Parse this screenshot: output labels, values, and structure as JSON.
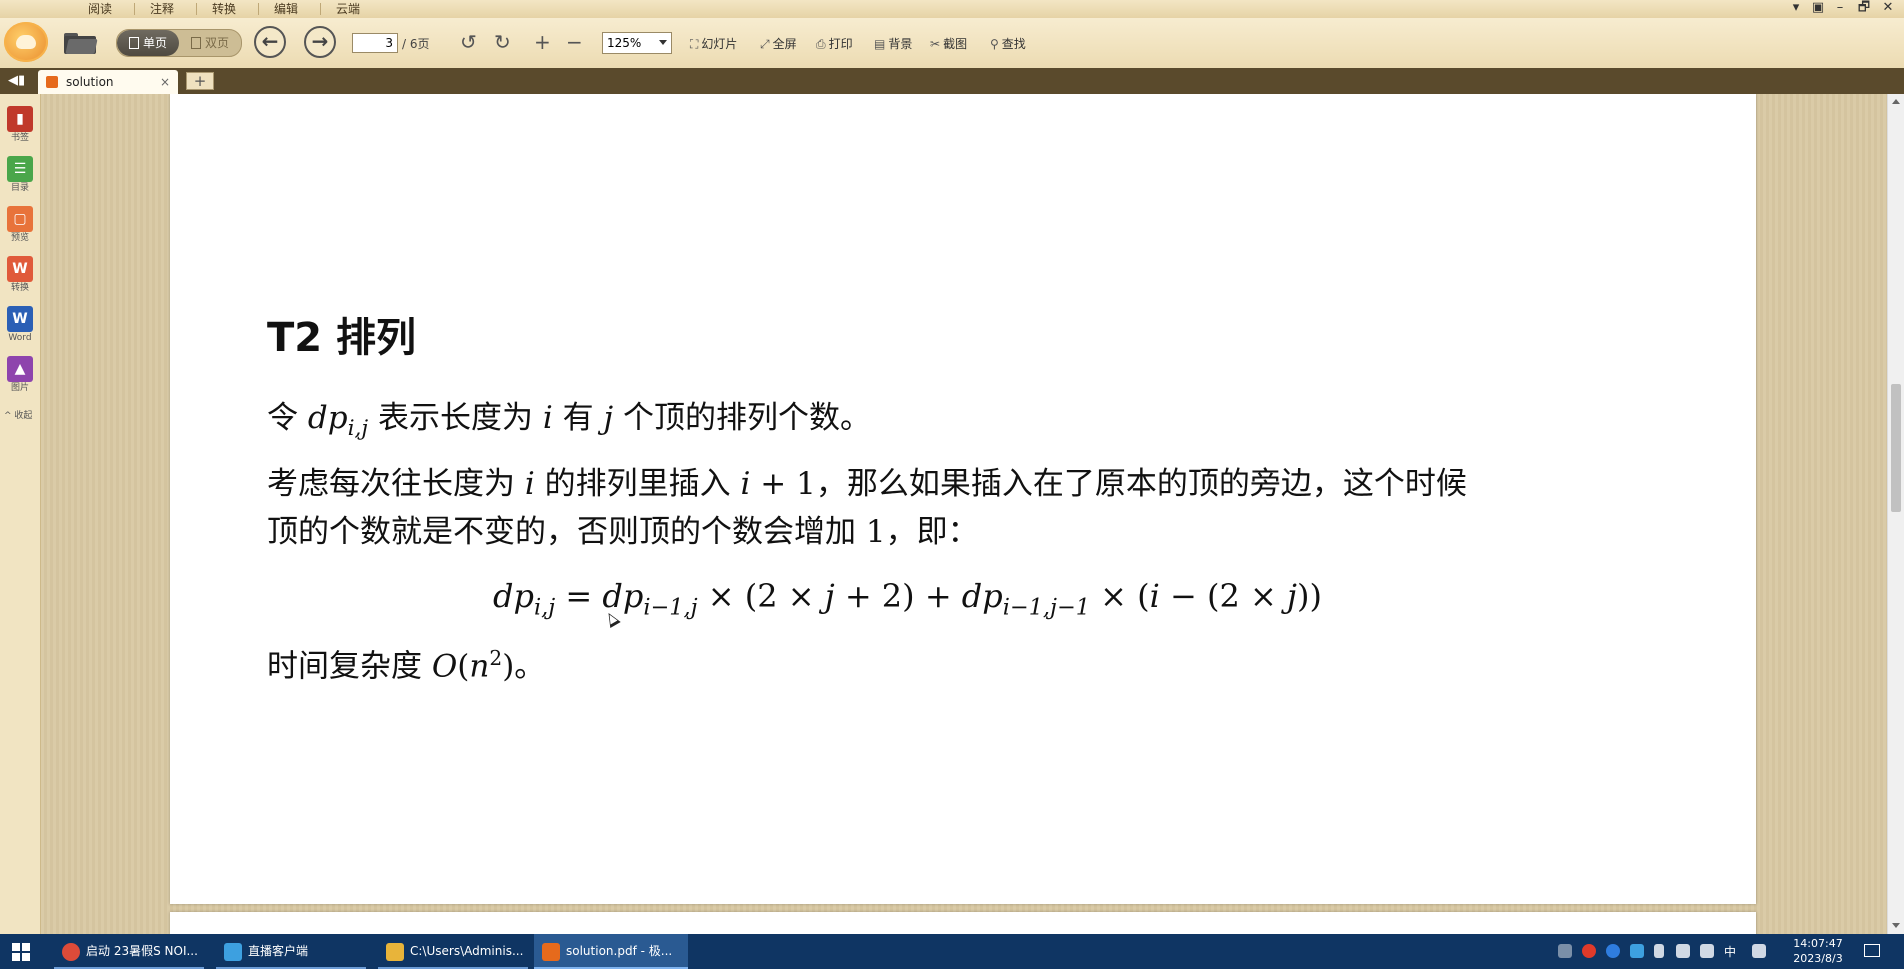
{
  "menu": {
    "tabs": [
      "阅读",
      "注释",
      "转换",
      "编辑",
      "云端"
    ],
    "window_controls": [
      "▾",
      "▣",
      "–",
      "🗗",
      "✕"
    ]
  },
  "toolbar": {
    "view_single": "单页",
    "view_double": "双页",
    "back_arrow": "←",
    "forward_arrow": "→",
    "current_page": "3",
    "total_pages": "/ 6页",
    "rotate_left": "↺",
    "rotate_right": "↻",
    "zoom_in": "+",
    "zoom_out": "−",
    "zoom_level": "125%",
    "slideshow": "幻灯片",
    "fullscreen": "全屏",
    "print": "打印",
    "background": "背景",
    "screenshot": "截图",
    "find": "查找"
  },
  "tabs": {
    "back_glyph": "◀▮",
    "doc_tab_label": "solution",
    "close_glyph": "×",
    "new_tab_glyph": "+"
  },
  "sidebar": {
    "items": [
      {
        "label": "书签",
        "icon": "bookmark-icon",
        "color": "#c0392b",
        "glyph": "▮"
      },
      {
        "label": "目录",
        "icon": "toc-icon",
        "color": "#4aa64a",
        "glyph": "☰"
      },
      {
        "label": "预览",
        "icon": "preview-icon",
        "color": "#e8733a",
        "glyph": "▢"
      },
      {
        "label": "转换",
        "icon": "convert-icon",
        "color": "#e05a3a",
        "glyph": "W"
      },
      {
        "label": "Word",
        "icon": "word-icon",
        "color": "#2b5fb5",
        "glyph": "W"
      },
      {
        "label": "图片",
        "icon": "image-icon",
        "color": "#8e44ad",
        "glyph": "▲"
      }
    ],
    "collapse": "^ 收起"
  },
  "document": {
    "heading": "T2 排列",
    "p1": {
      "a": "令 ",
      "m": "dp",
      "sub": "i,j",
      "b": " 表示长度为 ",
      "i": "i",
      "c": " 有 ",
      "j": "j",
      "d": " 个顶的排列个数。"
    },
    "p2": {
      "a": "考虑每次往长度为 ",
      "i": "i",
      "b": " 的排列里插入 ",
      "m": "i",
      "mn": " + 1",
      "c": "，那么如果插入在了原本的顶的旁边，这个时候",
      "d": "顶的个数就是不变的，否则顶的个数会增加 ",
      "one": "1",
      "e": "，即："
    },
    "equation": {
      "lhs": "dp",
      "lhs_sub": "i,j",
      "eq": " = ",
      "t1": "dp",
      "t1_sub": "i−1,j",
      "t1_rest": " × (2 × ",
      "t1_j": "j",
      "t1_end": " + 2) + ",
      "t2": "dp",
      "t2_sub": "i−1,j−1",
      "t2_rest": " × (",
      "t2_i": "i",
      "t2_mid": " − (2 × ",
      "t2_j": "j",
      "t2_end": "))"
    },
    "p3": {
      "a": "时间复杂度 ",
      "O": "O",
      "paren": "(",
      "n": "n",
      "sup": "2",
      "close": ")",
      "b": "。"
    }
  },
  "taskbar": {
    "items": [
      {
        "label": "启动 23暑假S NOI...",
        "color": "#dd4b39"
      },
      {
        "label": "直播客户端",
        "color": "#3da0e0"
      },
      {
        "label": "C:\\Users\\Adminis...",
        "color": "#e8b43a"
      },
      {
        "label": "solution.pdf - 极...",
        "color": "#e66a1c"
      }
    ],
    "ime": "中",
    "time": "14:07:47",
    "date": "2023/8/3"
  }
}
